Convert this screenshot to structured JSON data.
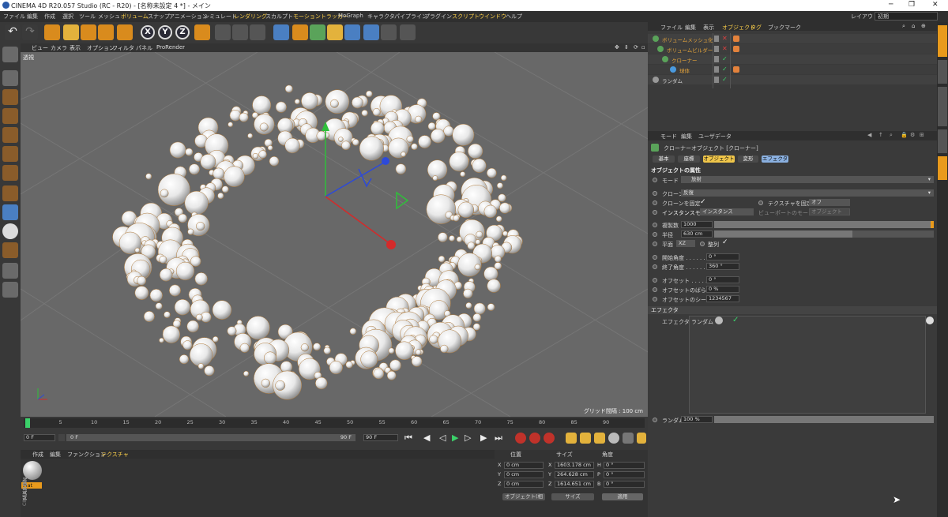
{
  "title_bar": {
    "title": "CINEMA 4D R20.057 Studio (RC - R20) - [名称未設定 4 *] - メイン"
  },
  "menu": {
    "items": [
      "ファイル",
      "編集",
      "作成",
      "選択",
      "ツール",
      "メッシュ",
      "ボリューム",
      "スナップ",
      "アニメーション",
      "シミュレート",
      "レンダリング",
      "スカルプト",
      "モーショントラッカー",
      "MoGraph",
      "キャラクタ",
      "パイプライン",
      "プラグイン",
      "スクリプト",
      "ウインドウ",
      "ヘルプ"
    ],
    "layout_label": "レイアウト:",
    "layout_value": "初期"
  },
  "viewport": {
    "menu": [
      "ビュー",
      "カメラ",
      "表示",
      "オプション",
      "フィルタ",
      "パネル",
      "ProRender"
    ],
    "mode_label": "透視",
    "grid_label": "グリッド間隔 : 100 cm"
  },
  "timeline": {
    "ticks": [
      "0",
      "5",
      "10",
      "15",
      "20",
      "25",
      "30",
      "35",
      "40",
      "45",
      "50",
      "55",
      "60",
      "65",
      "70",
      "75",
      "80",
      "85",
      "90"
    ],
    "current_frame": "0 F",
    "start_frame": "0 F",
    "slider_start": "0 F",
    "slider_end": "90 F",
    "end_frame": "90 F",
    "right_frame": "0 F"
  },
  "material_panel": {
    "menu": [
      "作成",
      "編集",
      "ファンクション",
      "テクスチャ"
    ],
    "material_name": "Mat",
    "brand_1": "MAXON",
    "brand_2": "CINEMA 4D"
  },
  "coordinates": {
    "headers": [
      "位置",
      "サイズ",
      "角度"
    ],
    "rows": [
      {
        "a": "X",
        "pos": "0 cm",
        "b": "X",
        "size": "1603.178 cm",
        "c": "H",
        "rot": "0 °"
      },
      {
        "a": "Y",
        "pos": "0 cm",
        "b": "Y",
        "size": "264.628 cm",
        "c": "P",
        "rot": "0 °"
      },
      {
        "a": "Z",
        "pos": "0 cm",
        "b": "Z",
        "size": "1614.651 cm",
        "c": "B",
        "rot": "0 °"
      }
    ],
    "mode_select": "オブジェクト(相",
    "size_select": "サイズ",
    "apply": "適用"
  },
  "object_manager": {
    "menu": [
      "ファイル",
      "編集",
      "表示",
      "オブジェクト",
      "タグ",
      "ブックマーク"
    ],
    "objects": [
      {
        "name": "ボリュームメッシュ化",
        "color": "#e2a23b"
      },
      {
        "name": "ボリュームビルダー",
        "color": "#e2a23b"
      },
      {
        "name": "クローナー",
        "color": "#e2a23b"
      },
      {
        "name": "球体",
        "color": "#e2a23b"
      },
      {
        "name": "ランダム",
        "color": "#d4d4d4"
      }
    ]
  },
  "attribute_manager": {
    "menu": [
      "モード",
      "編集",
      "ユーザデータ"
    ],
    "object_title": "クローナーオブジェクト [クローナー]",
    "tabs": [
      "基本",
      "座標",
      "オブジェクト",
      "変形",
      "エフェクタ"
    ],
    "section_title": "オブジェクトの属性",
    "mode_label": "モード",
    "mode_value": "放射",
    "clone_label": "クローン",
    "clone_value": "反復",
    "fix_clone_label": "クローンを固定",
    "fix_texture_label": "テクスチャを固定",
    "fix_texture_value": "オフ",
    "instance_mode_label": "インスタンスモード",
    "instance_mode_value": "インスタンス",
    "viewport_mode_label": "ビューポートのモード",
    "viewport_mode_value": "オブジェクト",
    "count_label": "複製数",
    "count_value": "1000",
    "radius_label": "半径",
    "radius_value": "630 cm",
    "plane_label": "平面",
    "plane_value": "XZ",
    "align_label": "整列",
    "start_angle_label": "開始角度 . . . . . .",
    "start_angle_value": "0 °",
    "end_angle_label": "終了角度 . . . . . .",
    "end_angle_value": "360 °",
    "offset_label": "オフセット . . . . . . .",
    "offset_value": "0 °",
    "offset_var_label": "オフセットのばらつき",
    "offset_var_value": "0 %",
    "offset_seed_label": "オフセットのシード",
    "offset_seed_value": "1234567",
    "effector_section": "エフェクタ",
    "effector_label": "エフェクタ",
    "effector_item": "ランダム",
    "random_label": "ランダム",
    "random_value": "100 %",
    "count_fill": 1.0,
    "radius_fill": 0.63,
    "random_fill": 1.0
  },
  "colors": {
    "accent_orange": "#e2a23b",
    "active_tab": "#f0c64a",
    "effector_tab": "#8ab0e0"
  }
}
